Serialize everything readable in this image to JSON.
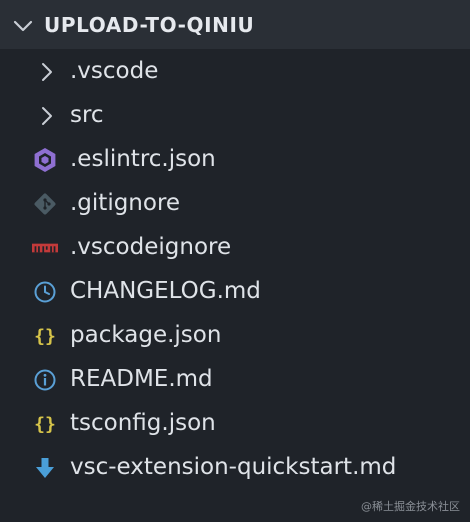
{
  "explorer": {
    "root_title": "UPLOAD-TO-QINIU",
    "items": [
      {
        "label": ".vscode",
        "type": "folder",
        "icon": "chevron-right-icon"
      },
      {
        "label": "src",
        "type": "folder",
        "icon": "chevron-right-icon"
      },
      {
        "label": ".eslintrc.json",
        "type": "file",
        "icon": "eslint-icon",
        "color": "#8e6fd1"
      },
      {
        "label": ".gitignore",
        "type": "file",
        "icon": "git-icon",
        "color": "#4a5a63"
      },
      {
        "label": ".vscodeignore",
        "type": "file",
        "icon": "npm-icon",
        "color": "#c33a3a"
      },
      {
        "label": "CHANGELOG.md",
        "type": "file",
        "icon": "clock-icon",
        "color": "#5aa0d6"
      },
      {
        "label": "package.json",
        "type": "file",
        "icon": "json-braces-icon",
        "color": "#d6c44a"
      },
      {
        "label": "README.md",
        "type": "file",
        "icon": "info-icon",
        "color": "#5aa0d6"
      },
      {
        "label": "tsconfig.json",
        "type": "file",
        "icon": "json-braces-icon",
        "color": "#d6c44a"
      },
      {
        "label": "vsc-extension-quickstart.md",
        "type": "file",
        "icon": "download-arrow-icon",
        "color": "#4a9fd8"
      }
    ]
  },
  "watermark": "@稀土掘金技术社区"
}
